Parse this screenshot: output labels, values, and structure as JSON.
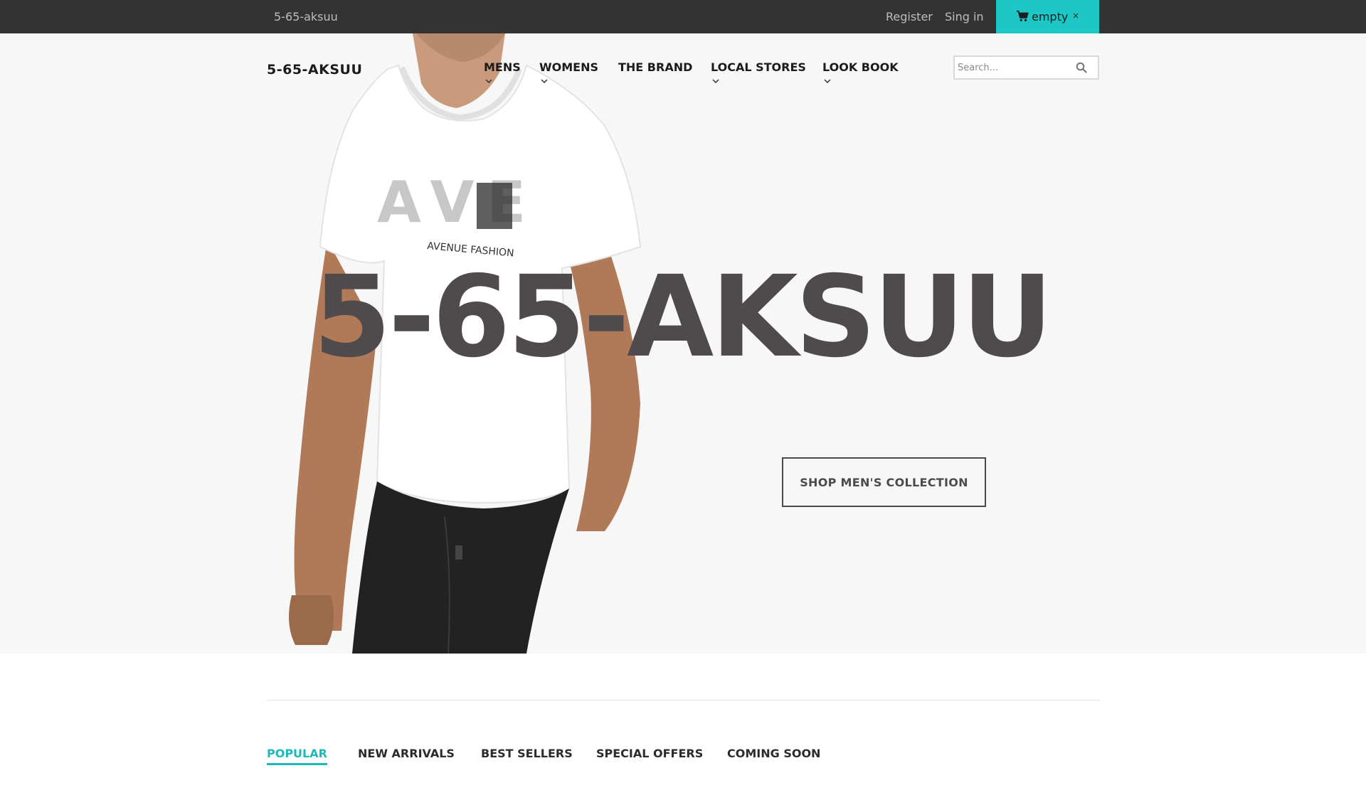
{
  "topbar": {
    "site_name": "5-65-aksuu",
    "register_label": "Register",
    "signin_label": "Sing in",
    "cart_label": "empty",
    "cart_close": "×",
    "cart_icon": "cart-icon"
  },
  "header": {
    "logo": "5-65-AKSUU",
    "nav": [
      {
        "label": "MENS",
        "has_dropdown": true
      },
      {
        "label": "WOMENS",
        "has_dropdown": true
      },
      {
        "label": "THE BRAND",
        "has_dropdown": false
      },
      {
        "label": "LOCAL STORES",
        "has_dropdown": true
      },
      {
        "label": "LOOK BOOK",
        "has_dropdown": true
      }
    ],
    "search": {
      "placeholder": "Search...",
      "value": "",
      "icon": "search-icon"
    }
  },
  "hero": {
    "shirt_logo": "AVE",
    "shirt_text": "AVENUE FASHION",
    "title": "5-65-AKSUU",
    "cta_label": "SHOP MEN'S COLLECTION"
  },
  "tabs": [
    {
      "label": "POPULAR",
      "active": true
    },
    {
      "label": "NEW ARRIVALS",
      "active": false
    },
    {
      "label": "BEST SELLERS",
      "active": false
    },
    {
      "label": "SPECIAL OFFERS",
      "active": false
    },
    {
      "label": "COMING SOON",
      "active": false
    }
  ],
  "colors": {
    "accent": "#1dc7c6",
    "topbar_bg": "#333333",
    "hero_bg": "#f7f7f7",
    "title_color": "#4f4b4c"
  }
}
